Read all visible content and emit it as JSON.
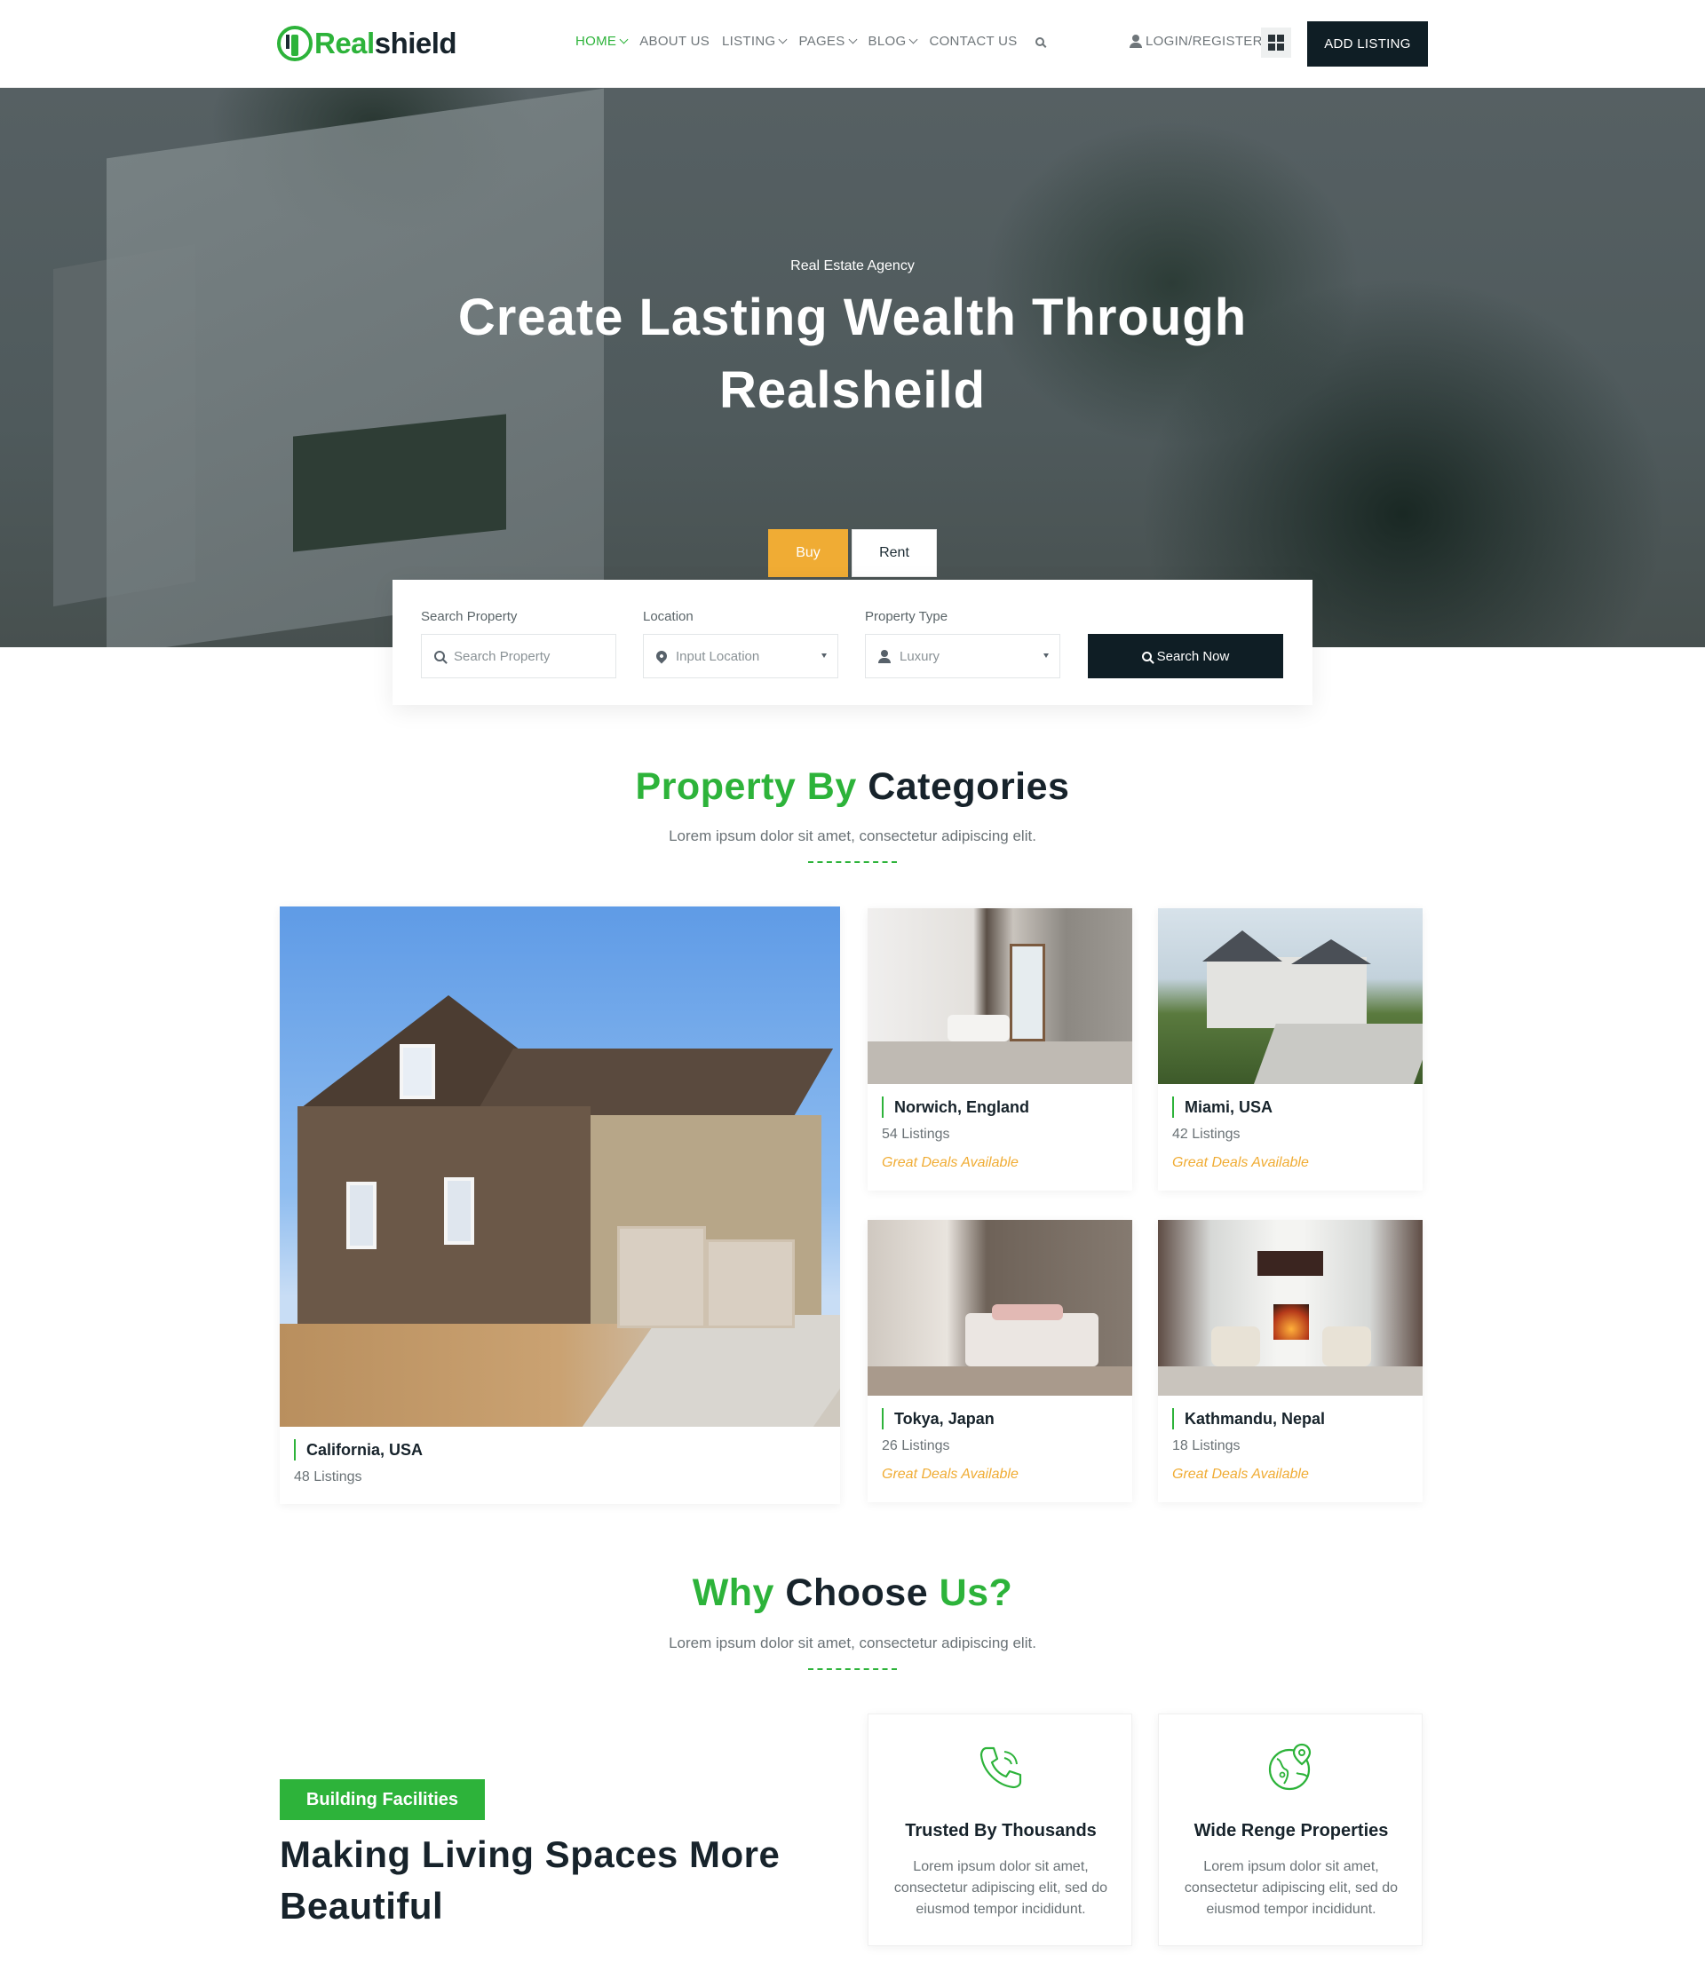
{
  "header": {
    "logo": {
      "part1": "Real",
      "part2": "shield"
    },
    "nav": [
      {
        "label": "HOME",
        "dropdown": true,
        "active": true
      },
      {
        "label": "ABOUT US",
        "dropdown": false
      },
      {
        "label": "LISTING",
        "dropdown": true
      },
      {
        "label": "PAGES",
        "dropdown": true
      },
      {
        "label": "BLOG",
        "dropdown": true
      },
      {
        "label": "CONTACT US",
        "dropdown": false
      }
    ],
    "login_label": "LOGIN/REGISTER",
    "add_listing_label": "ADD LISTING"
  },
  "hero": {
    "subtitle": "Real Estate Agency",
    "title": "Create Lasting Wealth Through Realsheild",
    "tabs": {
      "buy": "Buy",
      "rent": "Rent"
    }
  },
  "search": {
    "fields": [
      {
        "label": "Search Property",
        "placeholder": "Search Property",
        "icon": "search-icon"
      },
      {
        "label": "Location",
        "placeholder": "Input Location",
        "icon": "location-pin-icon"
      },
      {
        "label": "Property Type",
        "value": "Luxury",
        "icon": "user-icon"
      }
    ],
    "button_label": "Search Now"
  },
  "categories": {
    "title_green": "Property By",
    "title_dark": "Categories",
    "subtitle": "Lorem ipsum dolor sit amet, consectetur adipiscing elit.",
    "items": [
      {
        "name": "California, USA",
        "count": "48 Listings"
      },
      {
        "name": "Norwich, England",
        "count": "54 Listings",
        "deal": "Great Deals Available"
      },
      {
        "name": "Miami, USA",
        "count": "42 Listings",
        "deal": "Great Deals Available"
      },
      {
        "name": "Tokya, Japan",
        "count": "26 Listings",
        "deal": "Great Deals Available"
      },
      {
        "name": "Kathmandu, Nepal",
        "count": "18 Listings",
        "deal": "Great Deals Available"
      }
    ]
  },
  "why": {
    "title_green1": "Why",
    "title_dark": "Choose",
    "title_green2": "Us?",
    "subtitle": "Lorem ipsum dolor sit amet, consectetur adipiscing elit.",
    "badge": "Building Facilities",
    "heading": "Making Living Spaces More Beautiful",
    "features": [
      {
        "title": "Trusted By Thousands",
        "desc": "Lorem ipsum dolor sit amet, consectetur adipiscing elit, sed do eiusmod tempor incididunt.",
        "icon": "phone-icon"
      },
      {
        "title": "Wide Renge Properties",
        "desc": "Lorem ipsum dolor sit amet, consectetur adipiscing elit, sed do eiusmod tempor incididunt.",
        "icon": "globe-location-icon"
      }
    ]
  },
  "colors": {
    "accent": "#2db33a",
    "highlight": "#f0ac34",
    "dark": "#0f1e25"
  }
}
